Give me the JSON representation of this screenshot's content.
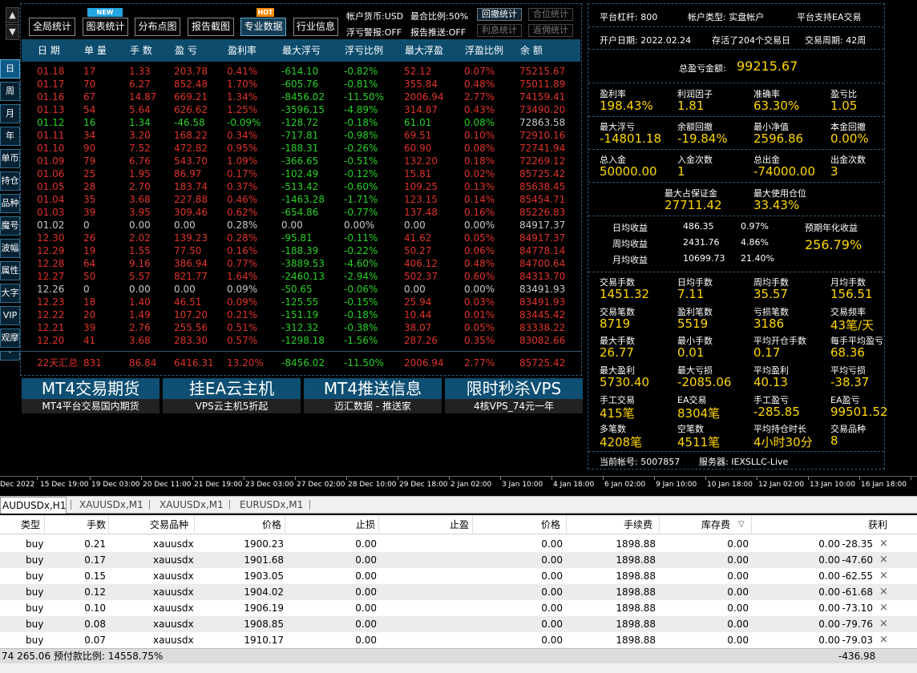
{
  "colors": {
    "up": "#e0322a",
    "down": "#26d126",
    "neutral": "#c8c8c8",
    "value": "#ffd700",
    "header": "#0d4c6d",
    "accent": "#0e4f73"
  },
  "nav": {
    "up": "▲",
    "down": "▼"
  },
  "sidebar": [
    {
      "label": "日"
    },
    {
      "label": "周"
    },
    {
      "label": "月"
    },
    {
      "label": "年"
    },
    {
      "label": "单币"
    },
    {
      "label": "持仓"
    },
    {
      "label": "品种"
    },
    {
      "label": "魔号"
    },
    {
      "label": "波幅"
    },
    {
      "label": "属性"
    },
    {
      "label": "大字"
    },
    {
      "label": "VIP"
    },
    {
      "label": "观摩"
    },
    {
      "label": "˅"
    }
  ],
  "toolbar": {
    "buttons": [
      {
        "label": "全局统计",
        "badge": ""
      },
      {
        "label": "图表统计",
        "badge": "NEW"
      },
      {
        "label": "分布点图",
        "badge": ""
      },
      {
        "label": "报告截图",
        "badge": ""
      },
      {
        "label": "专业数据",
        "badge": "HOT"
      },
      {
        "label": "行业信息",
        "badge": ""
      }
    ],
    "currency": "帐户货币:USD",
    "max_ratio": "最合比例:50%",
    "float_alert": "浮亏警报:OFF",
    "report_push": "报告推送:OFF",
    "stat_buttons": [
      "回撤统计",
      "合位统计",
      "利息统计",
      "返佣统计"
    ]
  },
  "table": {
    "headers": [
      "日 期",
      "单 量",
      "手 数",
      "盈 亏",
      "盈利率",
      "最大浮亏",
      "浮亏比例",
      "最大浮盈",
      "浮盈比例",
      "余 额"
    ],
    "rows": [
      {
        "date": "01.18",
        "orders": "17",
        "lots": "1.33",
        "pl": "203.78",
        "rate": "0.41%",
        "max_float_loss": "-614.10",
        "float_loss_ratio": "-0.82%",
        "max_float_profit": "52.12",
        "float_profit_ratio": "0.07%",
        "balance": "75215.67",
        "trend": "up"
      },
      {
        "date": "01.17",
        "orders": "70",
        "lots": "6.27",
        "pl": "852.48",
        "rate": "1.70%",
        "max_float_loss": "-605.76",
        "float_loss_ratio": "-0.81%",
        "max_float_profit": "355.84",
        "float_profit_ratio": "0.48%",
        "balance": "75011.89",
        "trend": "up"
      },
      {
        "date": "01.16",
        "orders": "67",
        "lots": "14.87",
        "pl": "669.21",
        "rate": "1.34%",
        "max_float_loss": "-8456.02",
        "float_loss_ratio": "-11.50%",
        "max_float_profit": "2006.94",
        "float_profit_ratio": "2.77%",
        "balance": "74159.41",
        "trend": "up"
      },
      {
        "date": "01.13",
        "orders": "54",
        "lots": "5.64",
        "pl": "626.62",
        "rate": "1.25%",
        "max_float_loss": "-3596.15",
        "float_loss_ratio": "-4.89%",
        "max_float_profit": "314.87",
        "float_profit_ratio": "0.43%",
        "balance": "73490.20",
        "trend": "up"
      },
      {
        "date": "01.12",
        "orders": "16",
        "lots": "1.34",
        "pl": "-46.58",
        "rate": "-0.09%",
        "max_float_loss": "-128.72",
        "float_loss_ratio": "-0.18%",
        "max_float_profit": "61.01",
        "float_profit_ratio": "0.08%",
        "balance": "72863.58",
        "trend": "down"
      },
      {
        "date": "01.11",
        "orders": "34",
        "lots": "3.20",
        "pl": "168.22",
        "rate": "0.34%",
        "max_float_loss": "-717.81",
        "float_loss_ratio": "-0.98%",
        "max_float_profit": "69.51",
        "float_profit_ratio": "0.10%",
        "balance": "72910.16",
        "trend": "up"
      },
      {
        "date": "01.10",
        "orders": "90",
        "lots": "7.52",
        "pl": "472.82",
        "rate": "0.95%",
        "max_float_loss": "-188.31",
        "float_loss_ratio": "-0.26%",
        "max_float_profit": "60.90",
        "float_profit_ratio": "0.08%",
        "balance": "72741.94",
        "trend": "up"
      },
      {
        "date": "01.09",
        "orders": "79",
        "lots": "6.76",
        "pl": "543.70",
        "rate": "1.09%",
        "max_float_loss": "-366.65",
        "float_loss_ratio": "-0.51%",
        "max_float_profit": "132.20",
        "float_profit_ratio": "0.18%",
        "balance": "72269.12",
        "trend": "up"
      },
      {
        "date": "01.06",
        "orders": "25",
        "lots": "1.95",
        "pl": "86.97",
        "rate": "0.17%",
        "max_float_loss": "-102.49",
        "float_loss_ratio": "-0.12%",
        "max_float_profit": "15.81",
        "float_profit_ratio": "0.02%",
        "balance": "85725.42",
        "trend": "up"
      },
      {
        "date": "01.05",
        "orders": "28",
        "lots": "2.70",
        "pl": "183.74",
        "rate": "0.37%",
        "max_float_loss": "-513.42",
        "float_loss_ratio": "-0.60%",
        "max_float_profit": "109.25",
        "float_profit_ratio": "0.13%",
        "balance": "85638.45",
        "trend": "up"
      },
      {
        "date": "01.04",
        "orders": "35",
        "lots": "3.68",
        "pl": "227.88",
        "rate": "0.46%",
        "max_float_loss": "-1463.28",
        "float_loss_ratio": "-1.71%",
        "max_float_profit": "123.15",
        "float_profit_ratio": "0.14%",
        "balance": "85454.71",
        "trend": "up"
      },
      {
        "date": "01.03",
        "orders": "39",
        "lots": "3.95",
        "pl": "309.46",
        "rate": "0.62%",
        "max_float_loss": "-654.86",
        "float_loss_ratio": "-0.77%",
        "max_float_profit": "137.48",
        "float_profit_ratio": "0.16%",
        "balance": "85226.83",
        "trend": "up"
      },
      {
        "date": "01.02",
        "orders": "0",
        "lots": "0.00",
        "pl": "0.00",
        "rate": "0.28%",
        "max_float_loss": "0.00",
        "float_loss_ratio": "0.00%",
        "max_float_profit": "0.00",
        "float_profit_ratio": "0.00%",
        "balance": "84917.37",
        "trend": "flat"
      },
      {
        "date": "12.30",
        "orders": "26",
        "lots": "2.02",
        "pl": "139.23",
        "rate": "0.28%",
        "max_float_loss": "-95.81",
        "float_loss_ratio": "-0.11%",
        "max_float_profit": "41.62",
        "float_profit_ratio": "0.05%",
        "balance": "84917.37",
        "trend": "up"
      },
      {
        "date": "12.29",
        "orders": "19",
        "lots": "1.55",
        "pl": "77.50",
        "rate": "0.16%",
        "max_float_loss": "-188.39",
        "float_loss_ratio": "-0.22%",
        "max_float_profit": "50.27",
        "float_profit_ratio": "0.06%",
        "balance": "84778.14",
        "trend": "up"
      },
      {
        "date": "12.28",
        "orders": "64",
        "lots": "9.16",
        "pl": "386.94",
        "rate": "0.77%",
        "max_float_loss": "-3889.53",
        "float_loss_ratio": "-4.60%",
        "max_float_profit": "406.12",
        "float_profit_ratio": "0.48%",
        "balance": "84700.64",
        "trend": "up"
      },
      {
        "date": "12.27",
        "orders": "50",
        "lots": "5.57",
        "pl": "821.77",
        "rate": "1.64%",
        "max_float_loss": "-2460.13",
        "float_loss_ratio": "-2.94%",
        "max_float_profit": "502.37",
        "float_profit_ratio": "0.60%",
        "balance": "84313.70",
        "trend": "up"
      },
      {
        "date": "12.26",
        "orders": "0",
        "lots": "0.00",
        "pl": "0.00",
        "rate": "0.09%",
        "max_float_loss": "-50.65",
        "float_loss_ratio": "-0.06%",
        "max_float_profit": "0.00",
        "float_profit_ratio": "0.00%",
        "balance": "83491.93",
        "trend": "flat"
      },
      {
        "date": "12.23",
        "orders": "18",
        "lots": "1.40",
        "pl": "46.51",
        "rate": "0.09%",
        "max_float_loss": "-125.55",
        "float_loss_ratio": "-0.15%",
        "max_float_profit": "25.94",
        "float_profit_ratio": "0.03%",
        "balance": "83491.93",
        "trend": "up"
      },
      {
        "date": "12.22",
        "orders": "20",
        "lots": "1.49",
        "pl": "107.20",
        "rate": "0.21%",
        "max_float_loss": "-151.19",
        "float_loss_ratio": "-0.18%",
        "max_float_profit": "10.44",
        "float_profit_ratio": "0.01%",
        "balance": "83445.42",
        "trend": "up"
      },
      {
        "date": "12.21",
        "orders": "39",
        "lots": "2.76",
        "pl": "255.56",
        "rate": "0.51%",
        "max_float_loss": "-312.32",
        "float_loss_ratio": "-0.38%",
        "max_float_profit": "38.07",
        "float_profit_ratio": "0.05%",
        "balance": "83338.22",
        "trend": "up"
      },
      {
        "date": "12.20",
        "orders": "41",
        "lots": "3.68",
        "pl": "283.30",
        "rate": "0.57%",
        "max_float_loss": "-1298.18",
        "float_loss_ratio": "-1.56%",
        "max_float_profit": "287.26",
        "float_profit_ratio": "0.35%",
        "balance": "83082.66",
        "trend": "up"
      }
    ],
    "summary": {
      "date": "22天汇总",
      "orders": "831",
      "lots": "86.84",
      "pl": "6416.31",
      "rate": "13.20%",
      "max_float_loss": "-8456.02",
      "float_loss_ratio": "-11.50%",
      "max_float_profit": "2006.94",
      "float_profit_ratio": "2.77%",
      "balance": "85725.42"
    }
  },
  "ads": [
    {
      "title": "MT4交易期货",
      "sub": "MT4平台交易国内期货"
    },
    {
      "title": "挂EA云主机",
      "sub": "VPS云主机5折起"
    },
    {
      "title": "MT4推送信息",
      "sub": "迈汇数据 - 推送家"
    },
    {
      "title": "限时秒杀VPS",
      "sub": "4核VPS_74元一年"
    }
  ],
  "stats": {
    "leverage": "平台杠杆:  800",
    "account_type": "帐户类型:  实盘帐户",
    "ea_support": "平台支持EA交易",
    "open_date": "开户日期:  2022.02.24",
    "survived": "存活了204个交易日",
    "trade_cycle": "交易周期:  42周",
    "total_pl_label": "总盈亏金额:",
    "total_pl": "99215.67",
    "g1": [
      {
        "label": "盈利率",
        "value": "198.43%"
      },
      {
        "label": "利润因子",
        "value": "1.81"
      },
      {
        "label": "准确率",
        "value": "63.30%"
      },
      {
        "label": "盈亏比",
        "value": "1.05"
      }
    ],
    "g2": [
      {
        "label": "最大浮亏",
        "value": "-14801.18"
      },
      {
        "label": "余额回撤",
        "value": "-19.84%"
      },
      {
        "label": "最小净值",
        "value": "2596.86"
      },
      {
        "label": "本金回撤",
        "value": "0.00%"
      }
    ],
    "g3": [
      {
        "label": "总入金",
        "value": "50000.00"
      },
      {
        "label": "入金次数",
        "value": "1"
      },
      {
        "label": "总出金",
        "value": "-74000.00"
      },
      {
        "label": "出金次数",
        "value": "3"
      }
    ],
    "margin": [
      {
        "label": "最大占保证金",
        "value": "27711.42"
      },
      {
        "label": "最大使用仓位",
        "value": "33.43%"
      }
    ],
    "avg": [
      {
        "label": "日均收益",
        "amount": "486.35",
        "pct": "0.97%"
      },
      {
        "label": "周均收益",
        "amount": "2431.76",
        "pct": "4.86%"
      },
      {
        "label": "月均收益",
        "amount": "10699.73",
        "pct": "21.40%"
      }
    ],
    "annual_label": "预期年化收益",
    "annual": "256.79%",
    "g4": [
      {
        "label": "交易手数",
        "value": "1451.32"
      },
      {
        "label": "日均手数",
        "value": "7.11"
      },
      {
        "label": "周均手数",
        "value": "35.57"
      },
      {
        "label": "月均手数",
        "value": "156.51"
      }
    ],
    "g5": [
      {
        "label": "交易笔数",
        "value": "8719"
      },
      {
        "label": "盈利笔数",
        "value": "5519"
      },
      {
        "label": "亏损笔数",
        "value": "3186"
      },
      {
        "label": "交易频率",
        "value": "43笔/天"
      }
    ],
    "g6": [
      {
        "label": "最大手数",
        "value": "26.77"
      },
      {
        "label": "最小手数",
        "value": "0.01"
      },
      {
        "label": "平均开仓手数",
        "value": "0.17"
      },
      {
        "label": "每手平均盈亏",
        "value": "68.36"
      }
    ],
    "g7": [
      {
        "label": "最大盈利",
        "value": "5730.40"
      },
      {
        "label": "最大亏损",
        "value": "-2085.06"
      },
      {
        "label": "平均盈利",
        "value": "40.13"
      },
      {
        "label": "平均亏损",
        "value": "-38.37"
      }
    ],
    "g8": [
      {
        "label": "手工交易",
        "value": "415笔"
      },
      {
        "label": "EA交易",
        "value": "8304笔"
      },
      {
        "label": "手工盈亏",
        "value": "-285.85"
      },
      {
        "label": "EA盈亏",
        "value": "99501.52"
      }
    ],
    "g9": [
      {
        "label": "多笔数",
        "value": "4208笔"
      },
      {
        "label": "空笔数",
        "value": "4511笔"
      },
      {
        "label": "平均持仓时长",
        "value": "4小时30分"
      },
      {
        "label": "交易品种",
        "value": "8"
      }
    ],
    "account": "当前帐号:  5007857",
    "server": "服务器:  IEXSLLC-Live"
  },
  "time_axis": [
    "Dec 2022",
    "15 Dec 19:00",
    "19 Dec 03:00",
    "20 Dec 11:00",
    "21 Dec 19:00",
    "23 Dec 03:00",
    "27 Dec 02:00",
    "28 Dec 10:00",
    "29 Dec 18:00",
    "2 Jan 02:00",
    "3 Jan 10:00",
    "4 Jan 18:00",
    "6 Jan 02:00",
    "9 Jan 10:00",
    "10 Jan 18:00",
    "12 Jan 02:00",
    "13 Jan 10:00",
    "16 Jan 18:00"
  ],
  "chart_tabs": [
    {
      "label": "AUDUSDx,H1"
    },
    {
      "label": "XAUUSDx,M1"
    },
    {
      "label": "XAUUSDx,M1"
    },
    {
      "label": "EURUSDx,M1"
    }
  ],
  "orders": {
    "headers": [
      "类型",
      "手数",
      "交易品种",
      "价格",
      "止损",
      "止盈",
      "价格",
      "手续费",
      "库存费",
      "获利"
    ],
    "sort_mark": "▽",
    "rows": [
      {
        "type": "buy",
        "lots": "0.21",
        "symbol": "xauusdx",
        "price": "1900.23",
        "sl": "0.00",
        "tp": "0.00",
        "cur": "1898.88",
        "comm": "0.00",
        "swap": "0.00",
        "profit": "-28.35"
      },
      {
        "type": "buy",
        "lots": "0.17",
        "symbol": "xauusdx",
        "price": "1901.68",
        "sl": "0.00",
        "tp": "0.00",
        "cur": "1898.88",
        "comm": "0.00",
        "swap": "0.00",
        "profit": "-47.60"
      },
      {
        "type": "buy",
        "lots": "0.15",
        "symbol": "xauusdx",
        "price": "1903.05",
        "sl": "0.00",
        "tp": "0.00",
        "cur": "1898.88",
        "comm": "0.00",
        "swap": "0.00",
        "profit": "-62.55"
      },
      {
        "type": "buy",
        "lots": "0.12",
        "symbol": "xauusdx",
        "price": "1904.02",
        "sl": "0.00",
        "tp": "0.00",
        "cur": "1898.88",
        "comm": "0.00",
        "swap": "0.00",
        "profit": "-61.68"
      },
      {
        "type": "buy",
        "lots": "0.10",
        "symbol": "xauusdx",
        "price": "1906.19",
        "sl": "0.00",
        "tp": "0.00",
        "cur": "1898.88",
        "comm": "0.00",
        "swap": "0.00",
        "profit": "-73.10"
      },
      {
        "type": "buy",
        "lots": "0.08",
        "symbol": "xauusdx",
        "price": "1908.85",
        "sl": "0.00",
        "tp": "0.00",
        "cur": "1898.88",
        "comm": "0.00",
        "swap": "0.00",
        "profit": "-79.76"
      },
      {
        "type": "buy",
        "lots": "0.07",
        "symbol": "xauusdx",
        "price": "1910.17",
        "sl": "0.00",
        "tp": "0.00",
        "cur": "1898.88",
        "comm": "0.00",
        "swap": "0.00",
        "profit": "-79.03"
      }
    ],
    "close_glyph": "×"
  },
  "status": {
    "left": "74 265.06  预付款比例: 14558.75%",
    "right": "-436.98"
  }
}
